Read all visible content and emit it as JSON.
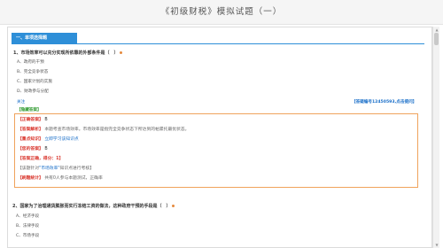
{
  "page": {
    "title": "《初级财税》模拟试题（一）"
  },
  "section": {
    "label": "一、单项选择题"
  },
  "q1": {
    "text": "1、市场效率可以充分实现所依靠的外部条件是（　）",
    "options": [
      "A、政府的干预",
      "B、完全竞争状态",
      "C、国家计划的实施",
      "D、财政参与分配"
    ],
    "follow_label": "关注",
    "ticket_link": "【答疑编号12450593,点击提问】"
  },
  "answer_panel": {
    "hidden_label": "【隐藏答案】",
    "correct_label": "【正确答案】",
    "correct_value": "B",
    "explain_label": "【答案解析】",
    "explain_text": "本题考查市场效率。市场效率是指完全竞争状态下所达到的帕累托最优状态。",
    "point_label": "【重点知识】",
    "point_link": "立即学习该知识点",
    "mine_label": "【您的答案】",
    "mine_value": "B",
    "eval_label": "【答案正确，得分：1】",
    "tip_label": "【该题针对",
    "tip_link": "\"市场效率\"",
    "tip_text": "知识点进行考核】",
    "stats_label": "【刷题统计】",
    "stats_text": "共有0人参与本题测试，正确率"
  },
  "q2": {
    "text": "2、国家为了治理通货膨胀而实行冻结工资的做法，这种政府干预的手段是（　）",
    "options": [
      "A、经济手段",
      "B、法律手段",
      "C、市场手段"
    ]
  },
  "scrollbar": {
    "up": "▲",
    "down": "▼"
  }
}
